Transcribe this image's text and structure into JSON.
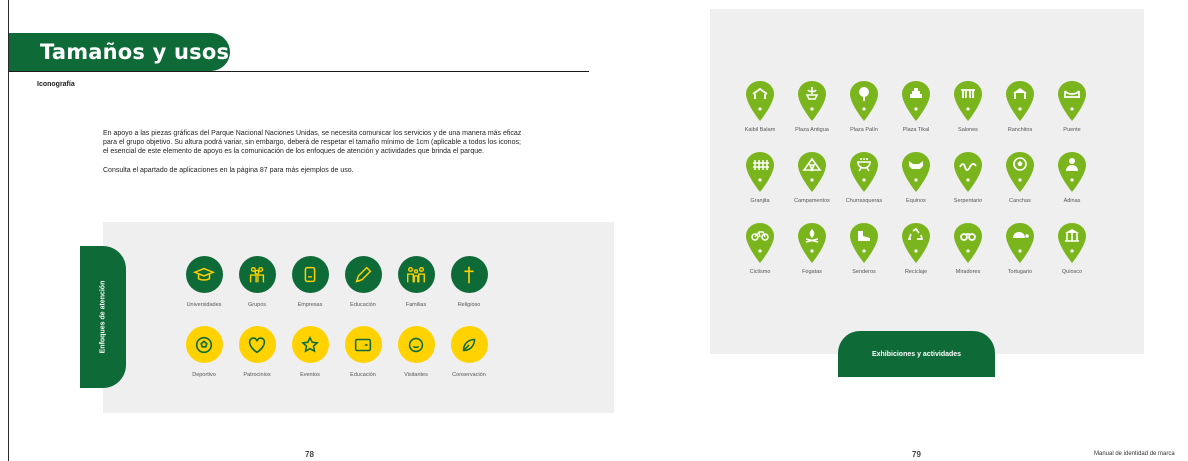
{
  "page": {
    "title": "Tamaños y usos",
    "section_label": "Iconografía",
    "paragraph_1": "En apoyo a las piezas gráficas del Parque Nacional Naciones Unidas, se necesita comunicar los servicios y de una manera más eficaz para el grupo objetivo. Su altura podrá variar, sin embargo, deberá de respetar el tamaño mínimo de 1cm (aplicable a todos los iconos; el esencial de este elemento de apoyo es la comunicación de los enfoques de atención y actividades que brinda el parque.",
    "paragraph_2": "Consulta el apartado de aplicaciones en la página 87 para más ejemplos de uso.",
    "left_tab_label": "Enfoques de atención",
    "right_ribbon_label": "Exhibiciones y actividades",
    "page_left_number": "78",
    "page_right_number": "79",
    "footer_text": "Manual de identidad de marca"
  },
  "colors": {
    "brand_green": "#0e6b37",
    "pin_green": "#7ab51d",
    "accent_yellow": "#ffd200",
    "panel_gray": "#efefef"
  },
  "focus_icons": {
    "green_row": [
      {
        "label": "Universidades",
        "icon": "graduation-cap-icon"
      },
      {
        "label": "Grupos",
        "icon": "group-icon"
      },
      {
        "label": "Empresas",
        "icon": "building-icon"
      },
      {
        "label": "Educación",
        "icon": "pencil-icon"
      },
      {
        "label": "Familias",
        "icon": "family-icon"
      },
      {
        "label": "Religioso",
        "icon": "cross-icon"
      }
    ],
    "yellow_row": [
      {
        "label": "Deportivo",
        "icon": "ball-icon"
      },
      {
        "label": "Patrocinios",
        "icon": "heart-icon"
      },
      {
        "label": "Eventos",
        "icon": "star-icon"
      },
      {
        "label": "Educación",
        "icon": "wallet-icon"
      },
      {
        "label": "Visitantes",
        "icon": "smile-icon"
      },
      {
        "label": "Conservación",
        "icon": "leaf-icon"
      }
    ]
  },
  "activity_pins": {
    "row_1": [
      {
        "label": "Kaibil Balam",
        "icon": "hut-icon"
      },
      {
        "label": "Plaza Antigua",
        "icon": "fountain-icon"
      },
      {
        "label": "Plaza Palín",
        "icon": "tree-icon"
      },
      {
        "label": "Plaza Tikal",
        "icon": "pyramid-icon"
      },
      {
        "label": "Salones",
        "icon": "hall-icon"
      },
      {
        "label": "Ranchitos",
        "icon": "ranch-icon"
      },
      {
        "label": "Puente",
        "icon": "bridge-icon"
      }
    ],
    "row_2": [
      {
        "label": "Granjita",
        "icon": "fence-icon"
      },
      {
        "label": "Campamentos",
        "icon": "tent-icon"
      },
      {
        "label": "Churrasqueras",
        "icon": "grill-icon"
      },
      {
        "label": "Equinos",
        "icon": "horse-icon"
      },
      {
        "label": "Serpentario",
        "icon": "snake-icon"
      },
      {
        "label": "Canchas",
        "icon": "court-ball-icon"
      },
      {
        "label": "Adinas",
        "icon": "person-icon"
      }
    ],
    "row_3": [
      {
        "label": "Ciclismo",
        "icon": "bicycle-icon"
      },
      {
        "label": "Fogatas",
        "icon": "campfire-icon"
      },
      {
        "label": "Senderos",
        "icon": "boot-icon"
      },
      {
        "label": "Reciclaje",
        "icon": "recycle-icon"
      },
      {
        "label": "Miradores",
        "icon": "binoculars-icon"
      },
      {
        "label": "Tortugario",
        "icon": "turtle-icon"
      },
      {
        "label": "Quiosco",
        "icon": "kiosk-icon"
      }
    ]
  }
}
